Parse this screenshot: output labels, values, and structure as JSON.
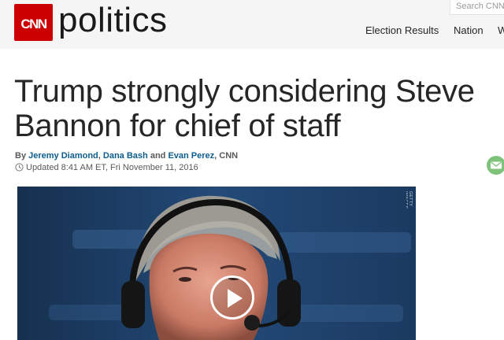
{
  "header": {
    "logo_text": "CNN",
    "section_name": "politics",
    "search_placeholder": "Search CNN...",
    "nav": [
      {
        "label": "Election Results"
      },
      {
        "label": "Nation"
      },
      {
        "label": "W"
      }
    ]
  },
  "article": {
    "headline_line1": "Trump strongly considering Steve",
    "headline_line2": "Bannon for chief of staff",
    "byline": {
      "prefix": "By",
      "author1": "Jeremy Diamond",
      "comma": ",",
      "author2": "Dana Bash",
      "and": "and",
      "author3": "Evan Perez",
      "suffix": ", CNN"
    },
    "updated": "Updated 8:41 AM ET, Fri November 11, 2016"
  },
  "video": {
    "photo_credit": "GETTY IMAGES"
  },
  "colors": {
    "brand": "#cc0000",
    "link": "#0c5d8c",
    "share_email": "#7fc37b"
  },
  "icons": [
    "cnn-logo",
    "clock-icon",
    "email-icon",
    "play-icon"
  ]
}
